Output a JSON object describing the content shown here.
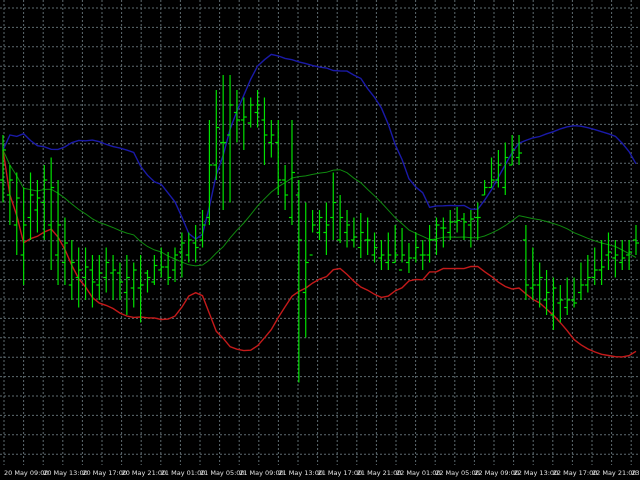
{
  "chart_data": {
    "type": "ohlc",
    "grid": true,
    "colors": {
      "background": "#000000",
      "grid": "#5e6b70",
      "bars": "#00e000",
      "upper_band": "#1a1aa8",
      "middle_band": "#0f8a0f",
      "lower_band": "#c41a1a",
      "tick_text": "#e6e6e6"
    },
    "x_tick_labels": [
      "20 May 09:00",
      "20 May 13:00",
      "20 May 17:00",
      "20 May 21:00",
      "21 May 01:00",
      "21 May 05:00",
      "21 May 09:00",
      "21 May 13:00",
      "21 May 17:00",
      "21 May 21:00",
      "22 May 01:00",
      "22 May 05:00",
      "22 May 09:00",
      "22 May 13:00",
      "22 May 17:00",
      "22 May 21:00",
      "23"
    ],
    "ohlc": [
      [
        190,
        210,
        220,
        175
      ],
      [
        180,
        190,
        200,
        160
      ],
      [
        160,
        178,
        195,
        140
      ],
      [
        140,
        160,
        185,
        120
      ],
      [
        165,
        180,
        195,
        150
      ],
      [
        170,
        178,
        190,
        155
      ],
      [
        175,
        190,
        200,
        150
      ],
      [
        160,
        185,
        205,
        130
      ],
      [
        140,
        160,
        190,
        120
      ],
      [
        135,
        148,
        165,
        120
      ],
      [
        120,
        135,
        150,
        110
      ],
      [
        125,
        130,
        145,
        105
      ],
      [
        125,
        132,
        145,
        110
      ],
      [
        130,
        122,
        140,
        105
      ],
      [
        120,
        128,
        140,
        110
      ],
      [
        125,
        135,
        145,
        115
      ],
      [
        128,
        130,
        140,
        110
      ],
      [
        128,
        122,
        135,
        110
      ],
      [
        115,
        125,
        140,
        100
      ],
      [
        118,
        130,
        135,
        105
      ],
      [
        118,
        120,
        140,
        95
      ],
      [
        128,
        125,
        130,
        115
      ],
      [
        122,
        133,
        140,
        120
      ],
      [
        130,
        132,
        145,
        125
      ],
      [
        132,
        125,
        142,
        120
      ],
      [
        130,
        140,
        145,
        122
      ],
      [
        142,
        148,
        155,
        125
      ],
      [
        140,
        150,
        155,
        135
      ],
      [
        148,
        145,
        160,
        135
      ],
      [
        150,
        160,
        170,
        145
      ],
      [
        165,
        200,
        230,
        160
      ],
      [
        200,
        225,
        250,
        190
      ],
      [
        215,
        215,
        260,
        170
      ],
      [
        220,
        240,
        260,
        175
      ],
      [
        235,
        230,
        250,
        215
      ],
      [
        230,
        232,
        245,
        210
      ],
      [
        228,
        240,
        245,
        225
      ],
      [
        235,
        240,
        250,
        225
      ],
      [
        230,
        220,
        245,
        200
      ],
      [
        215,
        220,
        230,
        205
      ],
      [
        215,
        190,
        230,
        180
      ],
      [
        190,
        180,
        200,
        170
      ],
      [
        165,
        195,
        230,
        160
      ],
      [
        180,
        150,
        190,
        55
      ],
      [
        115,
        135,
        175,
        85
      ],
      [
        140,
        160,
        170,
        155
      ],
      [
        155,
        165,
        170,
        150
      ],
      [
        155,
        160,
        175,
        140
      ],
      [
        165,
        175,
        195,
        150
      ],
      [
        150,
        165,
        180,
        148
      ],
      [
        155,
        160,
        170,
        145
      ],
      [
        150,
        152,
        165,
        145
      ],
      [
        145,
        155,
        168,
        138
      ],
      [
        150,
        150,
        165,
        140
      ],
      [
        140,
        145,
        155,
        135
      ],
      [
        138,
        140,
        150,
        130
      ],
      [
        135,
        140,
        155,
        130
      ],
      [
        135,
        140,
        160,
        135
      ],
      [
        130,
        140,
        158,
        135
      ],
      [
        135,
        138,
        148,
        128
      ],
      [
        138,
        145,
        155,
        135
      ],
      [
        140,
        140,
        150,
        130
      ],
      [
        140,
        150,
        160,
        135
      ],
      [
        150,
        160,
        165,
        140
      ],
      [
        158,
        158,
        165,
        145
      ],
      [
        155,
        162,
        170,
        150
      ],
      [
        162,
        163,
        172,
        155
      ],
      [
        164,
        162,
        168,
        150
      ],
      [
        160,
        164,
        170,
        145
      ],
      [
        165,
        165,
        175,
        150
      ],
      [
        180,
        185,
        190,
        180
      ],
      [
        185,
        190,
        205,
        185
      ],
      [
        190,
        200,
        210,
        185
      ],
      [
        185,
        205,
        215,
        180
      ],
      [
        200,
        210,
        220,
        200
      ],
      [
        205,
        208,
        220,
        200
      ],
      [
        150,
        120,
        160,
        110
      ],
      [
        118,
        120,
        145,
        110
      ],
      [
        120,
        125,
        135,
        105
      ],
      [
        110,
        115,
        130,
        100
      ],
      [
        100,
        118,
        125,
        90
      ],
      [
        108,
        110,
        120,
        95
      ],
      [
        105,
        110,
        125,
        100
      ],
      [
        110,
        108,
        125,
        105
      ],
      [
        115,
        120,
        135,
        110
      ],
      [
        120,
        125,
        140,
        115
      ],
      [
        125,
        130,
        145,
        120
      ],
      [
        130,
        132,
        150,
        120
      ],
      [
        140,
        142,
        155,
        130
      ],
      [
        138,
        140,
        150,
        125
      ],
      [
        135,
        138,
        150,
        130
      ],
      [
        140,
        142,
        150,
        130
      ],
      [
        150,
        148,
        160,
        140
      ]
    ]
  }
}
